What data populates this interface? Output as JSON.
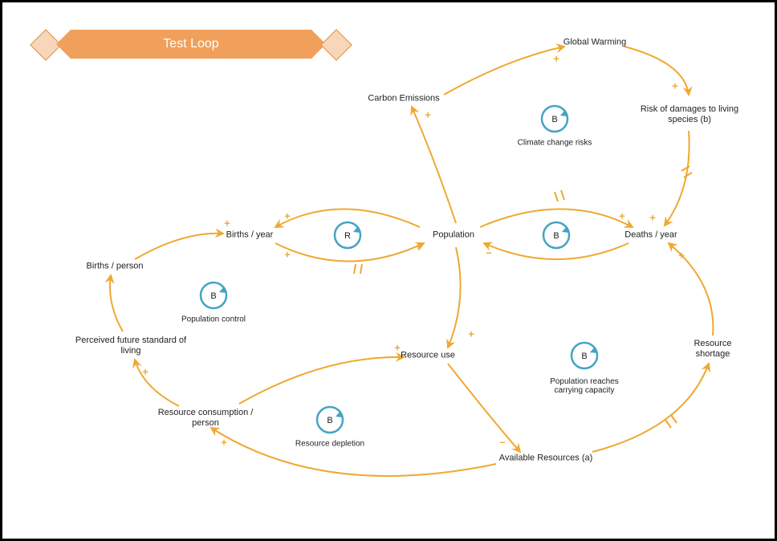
{
  "title": "Test Loop",
  "colors": {
    "arrow": "#f0a830",
    "loop": "#45a4c4",
    "banner": "#f0a05a",
    "diamond": "#f7d6b9"
  },
  "nodes": {
    "population": "Population",
    "births_year": "Births / year",
    "births_person": "Births / person",
    "perceived_std": "Perceived future standard of\nliving",
    "resource_cons": "Resource consumption /\nperson",
    "resource_use": "Resource use",
    "available_res": "Available Resources (a)",
    "resource_short": "Resource shortage",
    "deaths_year": "Deaths / year",
    "carbon": "Carbon Emissions",
    "global_warm": "Global Warming",
    "risk_damage": "Risk of damages to living\nspecies (b)"
  },
  "loops": {
    "pop_control": {
      "letter": "B",
      "label": "Population control"
    },
    "births_R": {
      "letter": "R",
      "label": ""
    },
    "deaths_B": {
      "letter": "B",
      "label": ""
    },
    "climate": {
      "letter": "B",
      "label": "Climate change risks"
    },
    "carrying": {
      "letter": "B",
      "label": "Population reaches\ncarrying capacity"
    },
    "depletion": {
      "letter": "B",
      "label": "Resource depletion"
    }
  },
  "links": [
    {
      "from": "population",
      "to": "births_year",
      "polarity": "+"
    },
    {
      "from": "births_year",
      "to": "population",
      "polarity": "+"
    },
    {
      "from": "population",
      "to": "deaths_year",
      "polarity": "+"
    },
    {
      "from": "deaths_year",
      "to": "population",
      "polarity": "−"
    },
    {
      "from": "population",
      "to": "carbon",
      "polarity": "+"
    },
    {
      "from": "carbon",
      "to": "global_warm",
      "polarity": "+"
    },
    {
      "from": "global_warm",
      "to": "risk_damage",
      "polarity": "+"
    },
    {
      "from": "risk_damage",
      "to": "deaths_year",
      "polarity": "+",
      "delay": true
    },
    {
      "from": "population",
      "to": "resource_use",
      "polarity": "+"
    },
    {
      "from": "resource_use",
      "to": "available_res",
      "polarity": "−"
    },
    {
      "from": "available_res",
      "to": "resource_short",
      "polarity": "",
      "delay": true
    },
    {
      "from": "resource_short",
      "to": "deaths_year",
      "polarity": "+"
    },
    {
      "from": "available_res",
      "to": "resource_cons",
      "polarity": "+"
    },
    {
      "from": "resource_cons",
      "to": "perceived_std",
      "polarity": "+"
    },
    {
      "from": "perceived_std",
      "to": "births_person",
      "polarity": ""
    },
    {
      "from": "births_person",
      "to": "births_year",
      "polarity": "+"
    },
    {
      "from": "resource_cons",
      "to": "resource_use",
      "polarity": "+"
    },
    {
      "from": "births_year",
      "to": "population",
      "polarity": "+",
      "delay": true
    }
  ]
}
